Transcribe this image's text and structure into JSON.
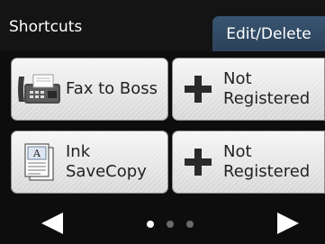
{
  "header": {
    "title": "Shortcuts",
    "edit_button": "Edit/Delete"
  },
  "tiles": [
    {
      "label": "Fax to Boss",
      "icon": "fax-machine-icon"
    },
    {
      "label": "Not\nRegistered",
      "icon": "plus-icon"
    },
    {
      "label": "Ink\nSaveCopy",
      "icon": "ink-save-document-icon"
    },
    {
      "label": "Not\nRegistered",
      "icon": "plus-icon"
    }
  ],
  "pagination": {
    "current_page": 1,
    "total_pages": 3
  },
  "nav": {
    "prev_icon": "triangle-left-icon",
    "next_icon": "triangle-right-icon"
  },
  "colors": {
    "background": "#0d0d0d",
    "edit_button": "#34506c",
    "tile_face": "#e6e6e6"
  }
}
